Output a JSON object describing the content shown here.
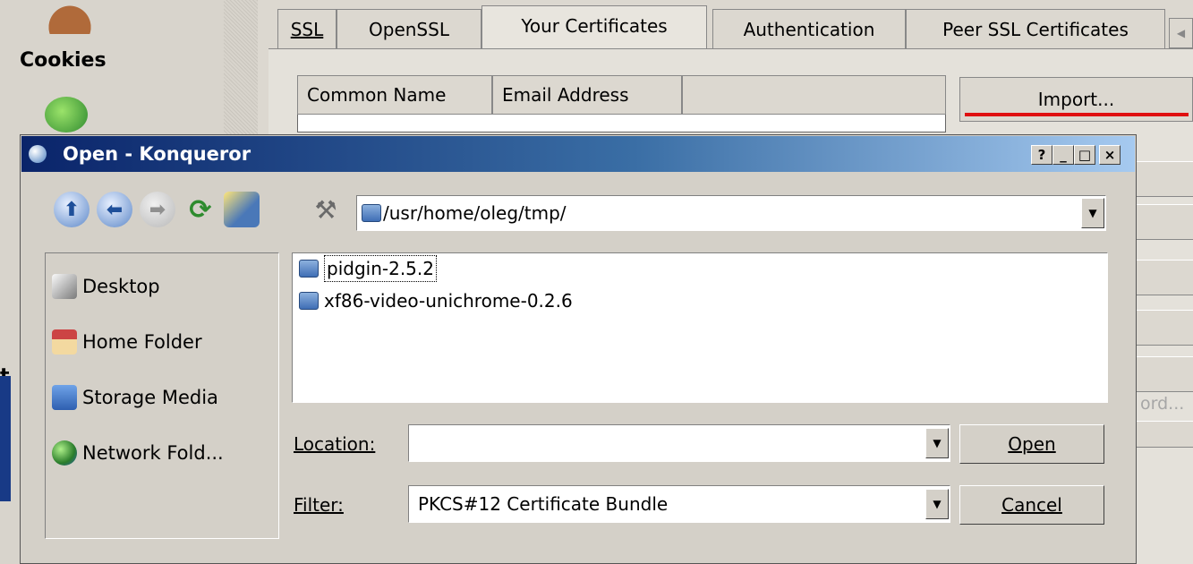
{
  "background": {
    "sidebar_label": "Cookies",
    "partial_letter": "t",
    "tabs": [
      "SSL",
      "OpenSSL",
      "Your Certificates",
      "Authentication",
      "Peer SSL Certificates"
    ],
    "columns": [
      "Common Name",
      "Email Address"
    ],
    "import_label": "Import...",
    "faded_button": "ord..."
  },
  "dialog": {
    "title": "Open - Konqueror",
    "title_buttons": [
      "?",
      "_",
      "□",
      "×"
    ],
    "path": "/usr/home/oleg/tmp/",
    "places": [
      "Desktop",
      "Home Folder",
      "Storage Media",
      "Network Fold..."
    ],
    "files": [
      "pidgin-2.5.2",
      "xf86-video-unichrome-0.2.6"
    ],
    "location_label": "Location:",
    "location_value": "",
    "filter_label": "Filter:",
    "filter_value": "PKCS#12 Certificate Bundle",
    "open_label": "Open",
    "cancel_label": "Cancel"
  },
  "colors": {
    "titlebar_start": "#0a246a",
    "titlebar_end": "#a6caf0",
    "import_underline": "#e01010"
  }
}
